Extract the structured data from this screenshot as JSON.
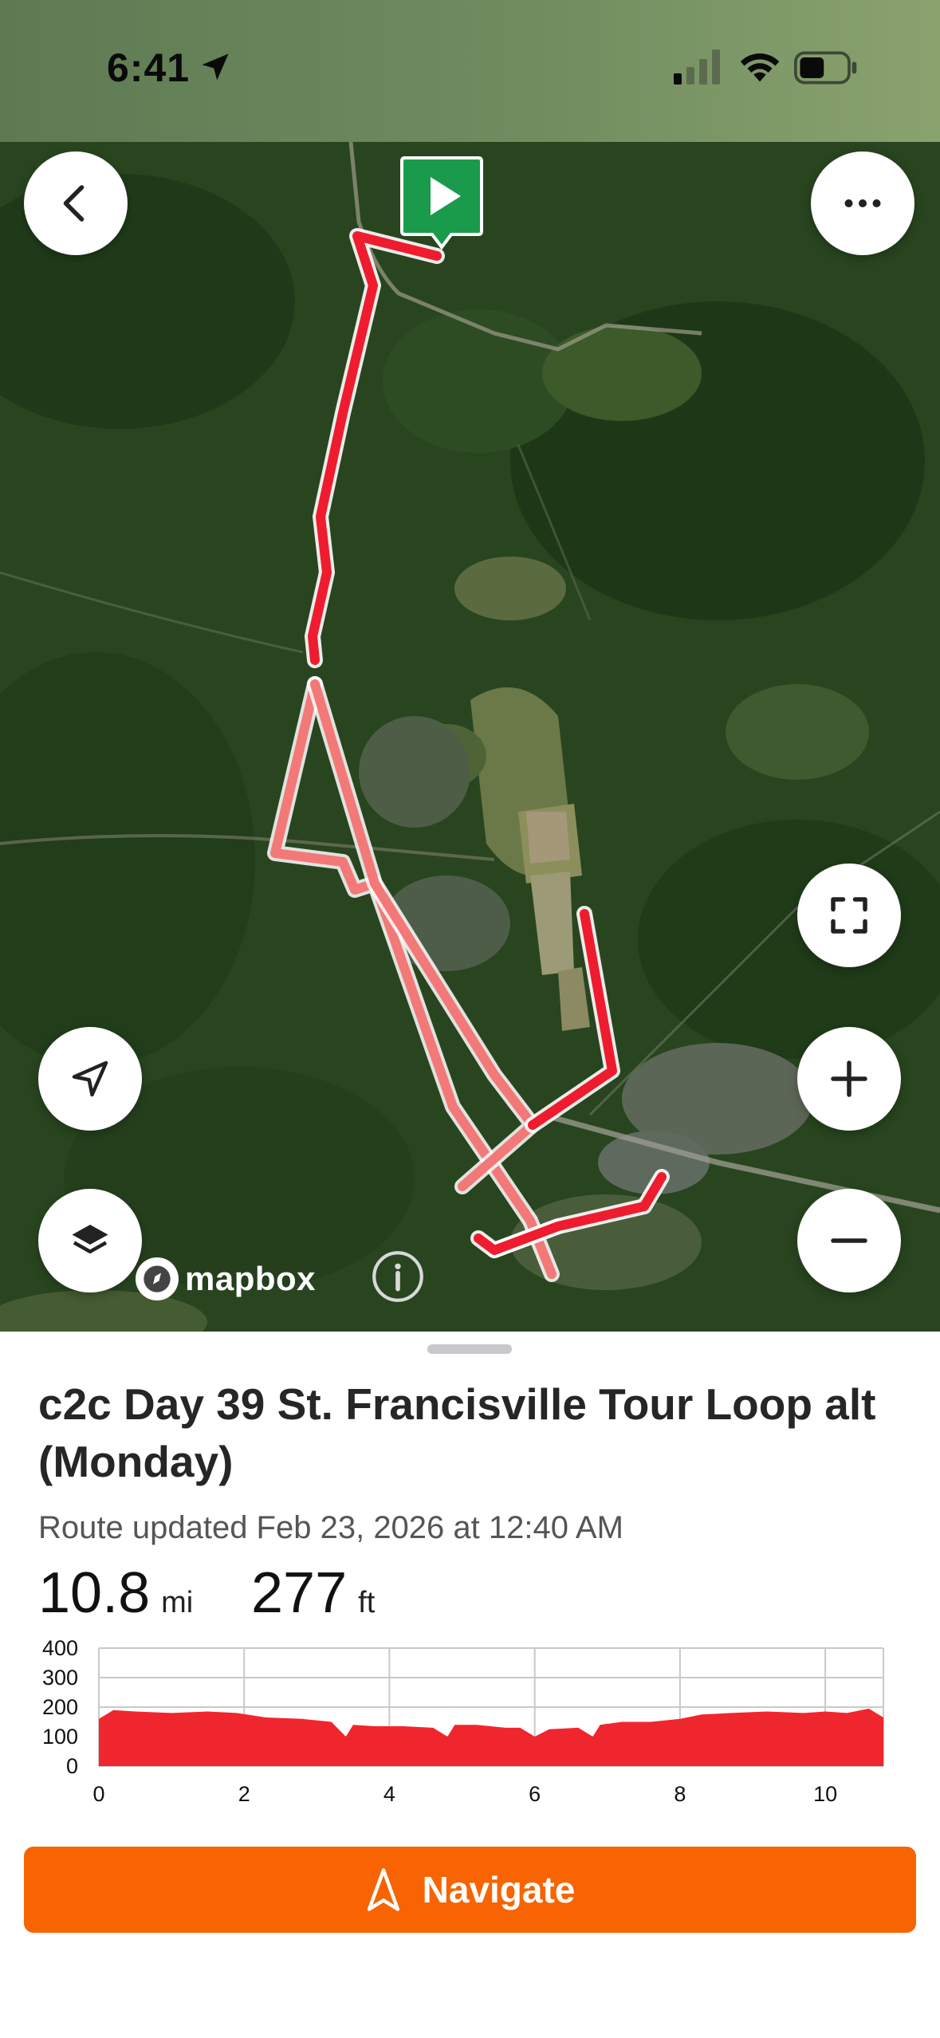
{
  "status_bar": {
    "time": "6:41",
    "icons": [
      "location-arrow-icon",
      "cellular-signal-icon",
      "wifi-icon",
      "battery-icon"
    ]
  },
  "map": {
    "attribution": "mapbox",
    "start_marker_icon": "play-icon",
    "route_color": "#ee1c2e",
    "controls": [
      "back-icon",
      "more-icon",
      "fullscreen-icon",
      "locate-icon",
      "zoom-in-icon",
      "layers-icon",
      "zoom-out-icon",
      "info-icon"
    ]
  },
  "route": {
    "title": "c2c Day 39 St. Francisville Tour Loop alt  (Monday)",
    "updated": "Route updated Feb 23, 2026 at 12:40 AM",
    "distance_value": "10.8",
    "distance_unit": "mi",
    "elevation_value": "277",
    "elevation_unit": "ft"
  },
  "chart_data": {
    "type": "area",
    "title": "",
    "xlabel": "",
    "ylabel": "",
    "x_ticks": [
      "0",
      "2",
      "4",
      "6",
      "8",
      "10"
    ],
    "y_ticks": [
      "400",
      "300",
      "200",
      "100",
      "0"
    ],
    "xlim": [
      0,
      10.8
    ],
    "ylim": [
      0,
      400
    ],
    "grid": true,
    "color": "#f0262e",
    "x": [
      0,
      0.2,
      0.5,
      1.0,
      1.5,
      1.9,
      2.3,
      2.8,
      3.2,
      3.4,
      3.5,
      3.8,
      4.2,
      4.6,
      4.8,
      4.9,
      5.2,
      5.6,
      5.8,
      6.0,
      6.2,
      6.6,
      6.8,
      6.9,
      7.2,
      7.6,
      8.0,
      8.3,
      8.7,
      9.2,
      9.7,
      10.0,
      10.3,
      10.6,
      10.8
    ],
    "y": [
      160,
      190,
      185,
      180,
      185,
      180,
      165,
      160,
      150,
      100,
      140,
      135,
      135,
      130,
      100,
      140,
      140,
      130,
      130,
      100,
      125,
      130,
      100,
      140,
      150,
      150,
      160,
      175,
      180,
      185,
      180,
      185,
      180,
      195,
      165
    ]
  },
  "navigate": {
    "label": "Navigate",
    "icon": "navigation-arrow-icon",
    "color": "#f76401"
  }
}
